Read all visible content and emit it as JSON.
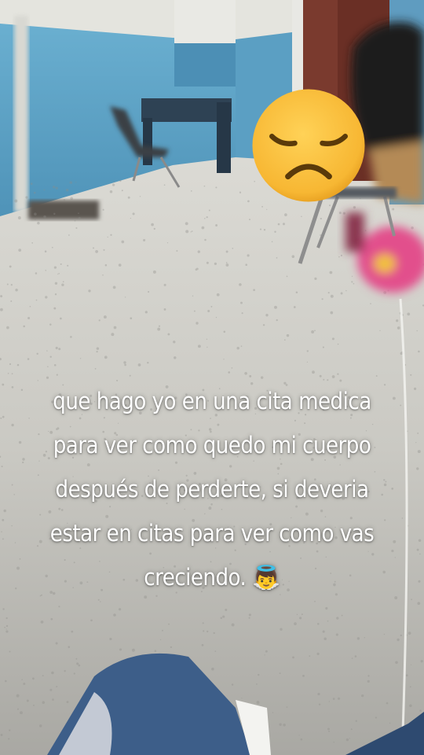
{
  "story": {
    "caption_lines": [
      "que hago yo en una cita medica",
      "para ver como quedo mi cuerpo",
      "después de perderte, si deveria",
      "estar en citas para ver como vas",
      "creciendo."
    ],
    "caption_emoji": "👼",
    "sticker_icon": "disappointed-face-emoji"
  },
  "colors": {
    "wall": "#5fa3c6",
    "floor": "#c9c8c2",
    "sticker_face": "#f7b733",
    "text": "#ffffff"
  }
}
